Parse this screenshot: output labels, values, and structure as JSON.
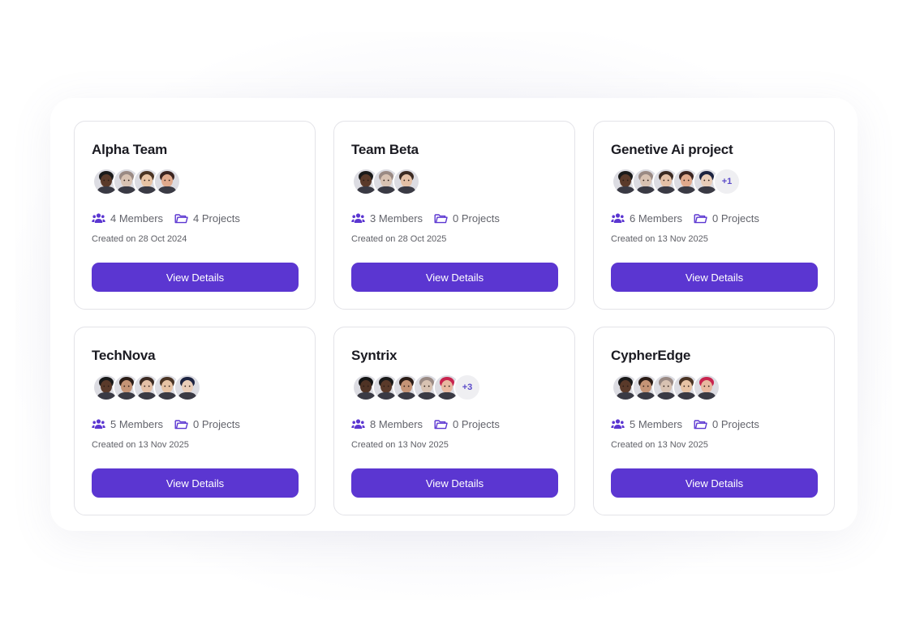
{
  "colors": {
    "accent": "#5b36d1",
    "icon": "#5b36d1",
    "border": "#e3e3e8"
  },
  "teams": [
    {
      "name": "Alpha Team",
      "members": "4 Members",
      "projects": "4 Projects",
      "created": "Created on 28 Oct 2024",
      "button": "View Details",
      "avatars": [
        {
          "skin": "#5a3a2a",
          "hair": "#1a1a1a"
        },
        {
          "skin": "#d8c2b2",
          "hair": "#9a8a84"
        },
        {
          "skin": "#e7c3a4",
          "hair": "#4a3424"
        },
        {
          "skin": "#e0a98c",
          "hair": "#3a2420"
        }
      ],
      "extra": ""
    },
    {
      "name": "Team Beta",
      "members": "3 Members",
      "projects": "0 Projects",
      "created": "Created on 28 Oct 2025",
      "button": "View Details",
      "avatars": [
        {
          "skin": "#5a3a2a",
          "hair": "#1a1a1a"
        },
        {
          "skin": "#d8c2b2",
          "hair": "#9a8a84"
        },
        {
          "skin": "#e4c0a6",
          "hair": "#3b2a22"
        }
      ],
      "extra": ""
    },
    {
      "name": "Genetive Ai project",
      "members": "6 Members",
      "projects": "0 Projects",
      "created": "Created on 13 Nov 2025",
      "button": "View Details",
      "avatars": [
        {
          "skin": "#5a3a2a",
          "hair": "#1a1a1a"
        },
        {
          "skin": "#d8c2b2",
          "hair": "#9a8a84"
        },
        {
          "skin": "#e4c0a6",
          "hair": "#3b2a22"
        },
        {
          "skin": "#e0a98c",
          "hair": "#3a2420"
        },
        {
          "skin": "#e9cdb8",
          "hair": "#1c2340"
        }
      ],
      "extra": "+1"
    },
    {
      "name": "TechNova",
      "members": "5 Members",
      "projects": "0 Projects",
      "created": "Created on 13 Nov 2025",
      "button": "View Details",
      "avatars": [
        {
          "skin": "#5a3a2a",
          "hair": "#1a1a1a"
        },
        {
          "skin": "#c59476",
          "hair": "#2a1c16"
        },
        {
          "skin": "#e4c0a6",
          "hair": "#3b2a22"
        },
        {
          "skin": "#e7c3a4",
          "hair": "#4a3424"
        },
        {
          "skin": "#e9cdb8",
          "hair": "#1c2340"
        }
      ],
      "extra": ""
    },
    {
      "name": "Syntrix",
      "members": "8 Members",
      "projects": "0 Projects",
      "created": "Created on 13 Nov 2025",
      "button": "View Details",
      "avatars": [
        {
          "skin": "#4f3325",
          "hair": "#151515"
        },
        {
          "skin": "#5a3a2a",
          "hair": "#1a1a1a"
        },
        {
          "skin": "#c59476",
          "hair": "#2a1c16"
        },
        {
          "skin": "#d8c2b2",
          "hair": "#9a8a84"
        },
        {
          "skin": "#e8b9a0",
          "hair": "#c8244e"
        }
      ],
      "extra": "+3"
    },
    {
      "name": "CypherEdge",
      "members": "5 Members",
      "projects": "0 Projects",
      "created": "Created on 13 Nov 2025",
      "button": "View Details",
      "avatars": [
        {
          "skin": "#5a3a2a",
          "hair": "#1a1a1a"
        },
        {
          "skin": "#c59476",
          "hair": "#2a1c16"
        },
        {
          "skin": "#d8c2b2",
          "hair": "#9a8a84"
        },
        {
          "skin": "#e7c3a4",
          "hair": "#4a3424"
        },
        {
          "skin": "#e8b9a0",
          "hair": "#c8244e"
        }
      ],
      "extra": ""
    }
  ]
}
